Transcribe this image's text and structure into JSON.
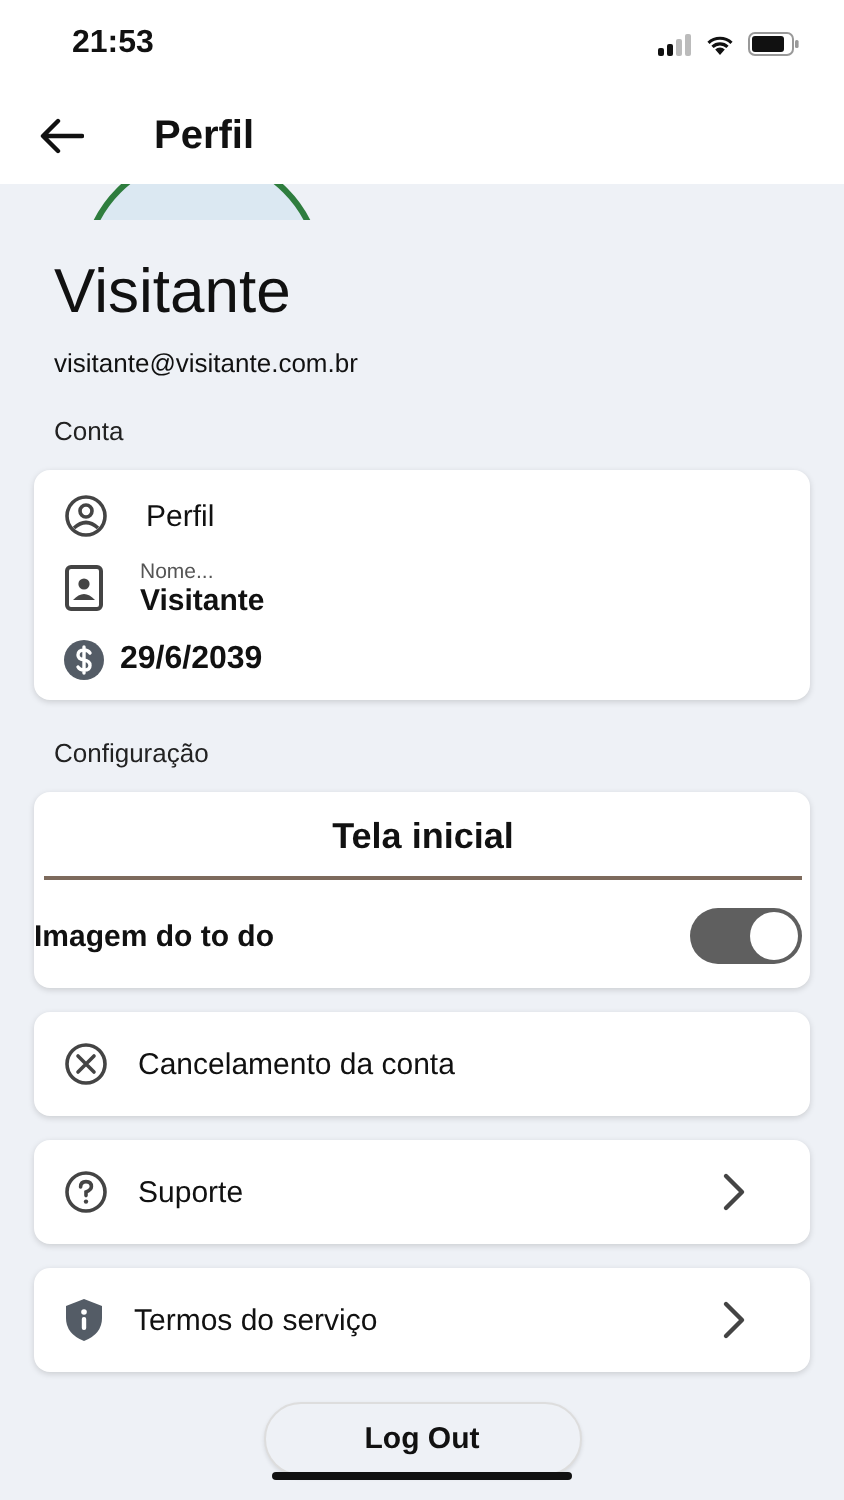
{
  "status_bar": {
    "time": "21:53"
  },
  "header": {
    "title": "Perfil"
  },
  "profile": {
    "name": "Visitante",
    "email": "visitante@visitante.com.br"
  },
  "account": {
    "section_label": "Conta",
    "rows": [
      {
        "kind": "link",
        "label": "Perfil"
      },
      {
        "kind": "field",
        "label": "Nome...",
        "value": "Visitante"
      },
      {
        "kind": "date",
        "value": "29/6/2039"
      }
    ]
  },
  "settings": {
    "section_label": "Configuração",
    "home_card": {
      "title": "Tela inicial",
      "toggle": {
        "label": "Imagem do to do",
        "on": true
      }
    },
    "items": [
      {
        "kind": "cancel",
        "label": "Cancelamento da conta",
        "chevron": false
      },
      {
        "kind": "help",
        "label": "Suporte",
        "chevron": true
      },
      {
        "kind": "terms",
        "label": "Termos do serviço",
        "chevron": true
      }
    ]
  },
  "logout": {
    "label": "Log Out"
  }
}
